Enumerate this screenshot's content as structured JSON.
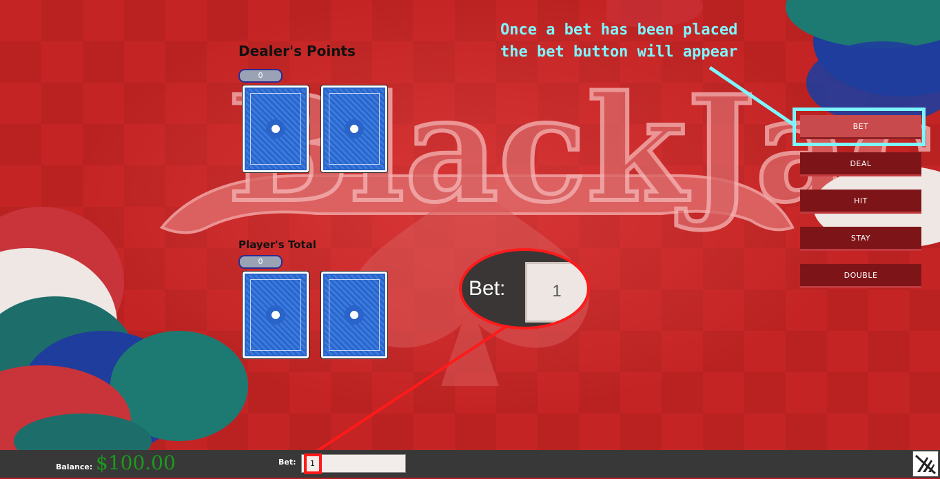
{
  "table": {
    "logo_text": "BlackJack"
  },
  "dealer": {
    "heading": "Dealer's Points",
    "points": "0",
    "cards": [
      "card-back",
      "card-back"
    ]
  },
  "player": {
    "heading": "Player's Total",
    "points": "0",
    "cards": [
      "card-back",
      "card-back"
    ]
  },
  "actions": {
    "bet": "BET",
    "deal": "DEAL",
    "hit": "HIT",
    "stay": "STAY",
    "double": "DOUBLE"
  },
  "annotation": {
    "text": "Once a bet has been placed\nthe bet button will appear",
    "color": "#7ef6ff"
  },
  "zoom": {
    "label": "Bet:",
    "value": "1",
    "highlight_color": "#ff1a1a"
  },
  "footer": {
    "balance_label": "Balance:",
    "balance_value": "$100.00",
    "bet_label": "Bet:",
    "bet_value": "1"
  },
  "icons": {
    "mute": "mute-sound-icon"
  }
}
